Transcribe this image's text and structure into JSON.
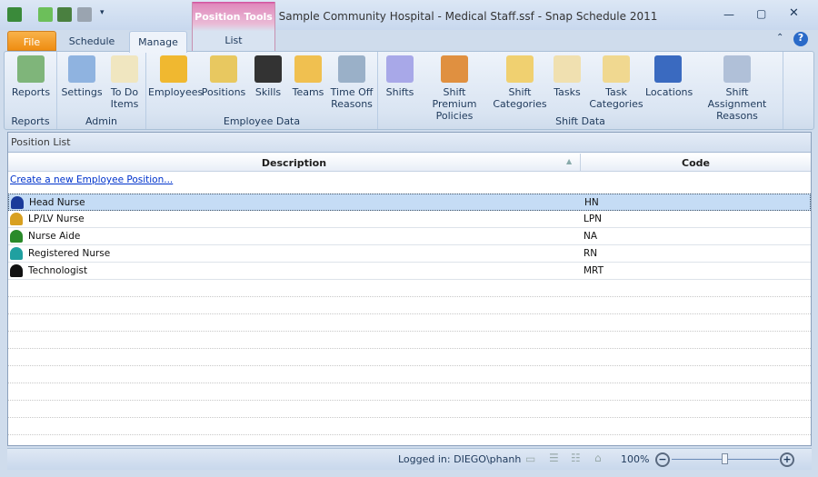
{
  "window": {
    "title": "Sample Community Hospital - Medical Staff.ssf - Snap Schedule 2011"
  },
  "context_tab": {
    "group": "Position Tools",
    "tab": "List"
  },
  "tabs": [
    {
      "label": "File"
    },
    {
      "label": "Schedule"
    },
    {
      "label": "Manage"
    }
  ],
  "ribbon": {
    "groups": [
      {
        "label": "Reports",
        "buttons": [
          {
            "label": "Reports",
            "icon": "reports-icon"
          }
        ]
      },
      {
        "label": "Admin",
        "buttons": [
          {
            "label": "Settings",
            "icon": "settings-icon"
          },
          {
            "label": "To Do Items",
            "icon": "todo-icon"
          }
        ]
      },
      {
        "label": "Employee Data",
        "buttons": [
          {
            "label": "Employees",
            "icon": "employees-icon"
          },
          {
            "label": "Positions",
            "icon": "positions-icon"
          },
          {
            "label": "Skills",
            "icon": "skills-icon"
          },
          {
            "label": "Teams",
            "icon": "teams-icon"
          },
          {
            "label": "Time Off Reasons",
            "icon": "time-off-icon"
          }
        ]
      },
      {
        "label": "Shift Data",
        "buttons": [
          {
            "label": "Shifts",
            "icon": "shifts-icon"
          },
          {
            "label": "Shift Premium Policies",
            "icon": "premium-icon"
          },
          {
            "label": "Shift Categories",
            "icon": "categories-icon"
          },
          {
            "label": "Tasks",
            "icon": "tasks-icon"
          },
          {
            "label": "Task Categories",
            "icon": "task-categories-icon"
          },
          {
            "label": "Locations",
            "icon": "locations-icon"
          },
          {
            "label": "Shift Assignment Reasons",
            "icon": "assignment-reasons-icon"
          }
        ]
      }
    ]
  },
  "panel": {
    "title": "Position List",
    "columns": [
      "Description",
      "Code"
    ],
    "create_link": "Create a new Employee Position...",
    "rows": [
      {
        "description": "Head Nurse",
        "code": "HN",
        "color": "#1a3a9a",
        "selected": true
      },
      {
        "description": "LP/LV Nurse",
        "code": "LPN",
        "color": "#d8a020"
      },
      {
        "description": "Nurse Aide",
        "code": "NA",
        "color": "#2a8a2a"
      },
      {
        "description": "Registered Nurse",
        "code": "RN",
        "color": "#20a0a0"
      },
      {
        "description": "Technologist",
        "code": "MRT",
        "color": "#111111"
      }
    ]
  },
  "status": {
    "logged_in": "Logged in: DIEGO\\phanh",
    "zoom": "100%",
    "zoom_level": 50
  }
}
